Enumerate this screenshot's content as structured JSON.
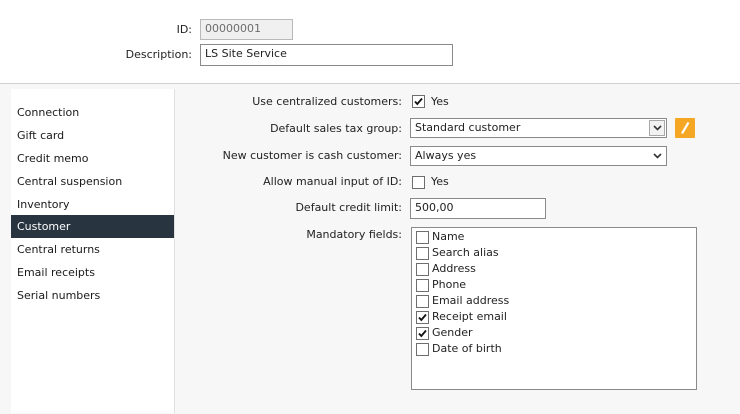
{
  "header": {
    "id_label": "ID:",
    "id_value": "00000001",
    "description_label": "Description:",
    "description_value": "LS Site Service"
  },
  "nav": {
    "items": [
      {
        "label": "Connection"
      },
      {
        "label": "Gift card"
      },
      {
        "label": "Credit  memo"
      },
      {
        "label": "Central suspension"
      },
      {
        "label": "Inventory"
      },
      {
        "label": "Customer"
      },
      {
        "label": "Central returns"
      },
      {
        "label": "Email receipts"
      },
      {
        "label": "Serial numbers"
      }
    ],
    "active": "Customer"
  },
  "form": {
    "centralized": {
      "label": "Use centralized customers:",
      "checked": true,
      "text": "Yes"
    },
    "sales_tax": {
      "label": "Default sales tax group:",
      "value": "Standard customer"
    },
    "cash_customer": {
      "label": "New customer is cash customer:",
      "value": "Always yes"
    },
    "manual_id": {
      "label": "Allow manual input of ID:",
      "checked": false,
      "text": "Yes"
    },
    "credit_limit": {
      "label": "Default credit limit:",
      "value": "500,00"
    },
    "mandatory": {
      "label": "Mandatory fields:",
      "items": [
        {
          "label": "Name",
          "checked": false
        },
        {
          "label": "Search alias",
          "checked": false
        },
        {
          "label": "Address",
          "checked": false
        },
        {
          "label": "Phone",
          "checked": false
        },
        {
          "label": "Email address",
          "checked": false
        },
        {
          "label": "Receipt email",
          "checked": true
        },
        {
          "label": "Gender",
          "checked": true
        },
        {
          "label": "Date of birth",
          "checked": false
        }
      ]
    }
  },
  "colors": {
    "nav_active_bg": "#283440",
    "edit_button": "#f5a623"
  },
  "icons": {
    "combo_arrow": "chevron-down-icon",
    "edit": "pencil-icon",
    "check": "check-icon"
  }
}
